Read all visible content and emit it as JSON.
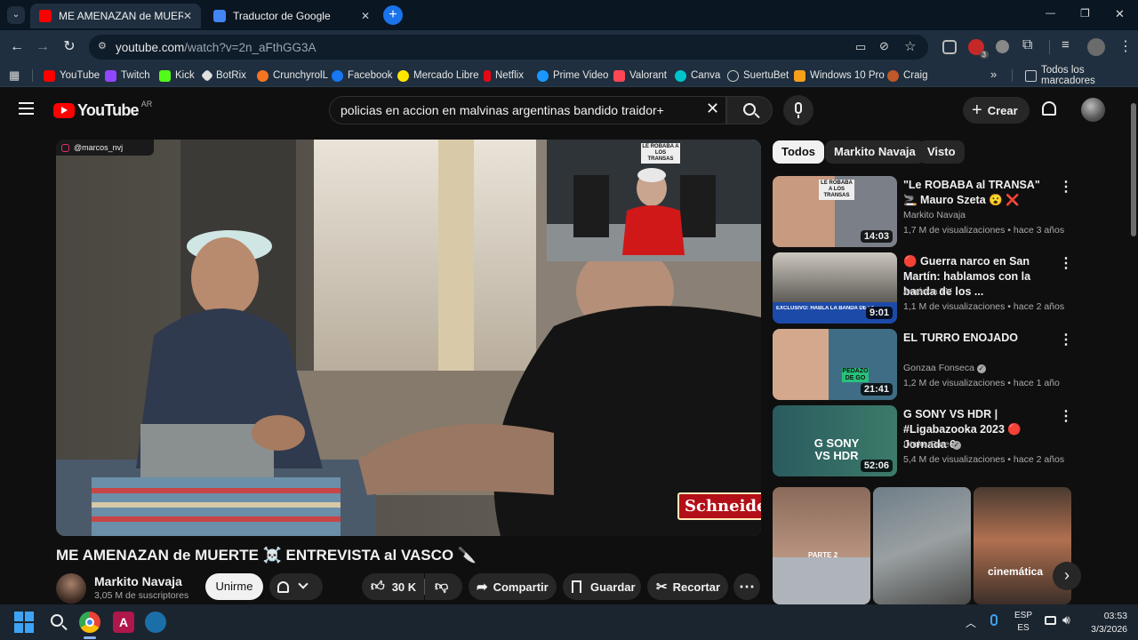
{
  "browser": {
    "tabs": [
      {
        "title": "ME AMENAZAN de MUERTE ☠️",
        "active": true
      },
      {
        "title": "Traductor de Google",
        "active": false
      }
    ],
    "url_host": "youtube.com",
    "url_path": "/watch?v=2n_aFthGG3A",
    "bookmarks": [
      "YouTube",
      "Twitch",
      "Kick",
      "BotRix",
      "CrunchyrolL",
      "Facebook",
      "Mercado Libre",
      "Netflix",
      "Prime Video",
      "Valorant",
      "Canva",
      "SuertuBet",
      "Windows 10 Pro",
      "Craig"
    ],
    "all_bookmarks": "Todos los marcadores",
    "bookmark_more": "»",
    "extension_badge": "3",
    "window_controls": {
      "minimize": "—",
      "maximize": "❐",
      "close": "✕"
    }
  },
  "youtube": {
    "logo_text": "YouTube",
    "region": "AR",
    "search_value": "policias en accion en malvinas argentinas bandido traidor+",
    "create_label": "Crear",
    "video": {
      "title": "ME AMENAZAN de MUERTE ☠️ ENTREVISTA al VASCO 🔪",
      "watermark": "@marcos_nvj",
      "sponsor": "Schneider",
      "pip_sign": "LE ROBABA A LOS TRANSAS",
      "channel": "Markito Navaja",
      "subscribers": "3,05 M de suscriptores",
      "join_label": "Unirme",
      "likes": "30 K",
      "share_label": "Compartir",
      "save_label": "Guardar",
      "clip_label": "Recortar"
    },
    "chips": [
      "Todos",
      "Markito Navaja",
      "Visto"
    ],
    "recommendations": [
      {
        "title": "\"Le ROBABA al TRANSA\" 🚬 Mauro Szeta 😮 ❌",
        "channel": "Markito Navaja",
        "meta": "1,7 M de visualizaciones • hace 3 años",
        "duration": "14:03",
        "verified": false,
        "overlay": "LE ROBABA A LOS TRANSAS"
      },
      {
        "title": "🔴 Guerra narco en San Martín: hablamos con la banda de los ...",
        "channel": "América TV",
        "meta": "1,1 M de visualizaciones • hace 2 años",
        "duration": "9:01",
        "verified": false,
        "overlay": "EXCLUSIVO: HABLA LA BANDA DE LOS PAYO"
      },
      {
        "title": "EL TURRO ENOJADO",
        "channel": "Gonzaa Fonseca",
        "meta": "1,2 M de visualizaciones • hace 1 año",
        "duration": "21:41",
        "verified": true,
        "overlay": "PEDAZO DE GO"
      },
      {
        "title": "G SONY VS HDR | #Ligabazooka 2023 🔴 Jornada 6",
        "channel": "Dtoke Free",
        "meta": "5,4 M de visualizaciones • hace 2 años",
        "duration": "52:06",
        "verified": true,
        "overlay": "G SONY VS HDR"
      }
    ],
    "shorts_overlays": [
      "PARTE 2",
      "cinemática"
    ]
  },
  "taskbar": {
    "lang_top": "ESP",
    "lang_bottom": "ES",
    "time": "03:53",
    "date": "3/3/2026"
  }
}
